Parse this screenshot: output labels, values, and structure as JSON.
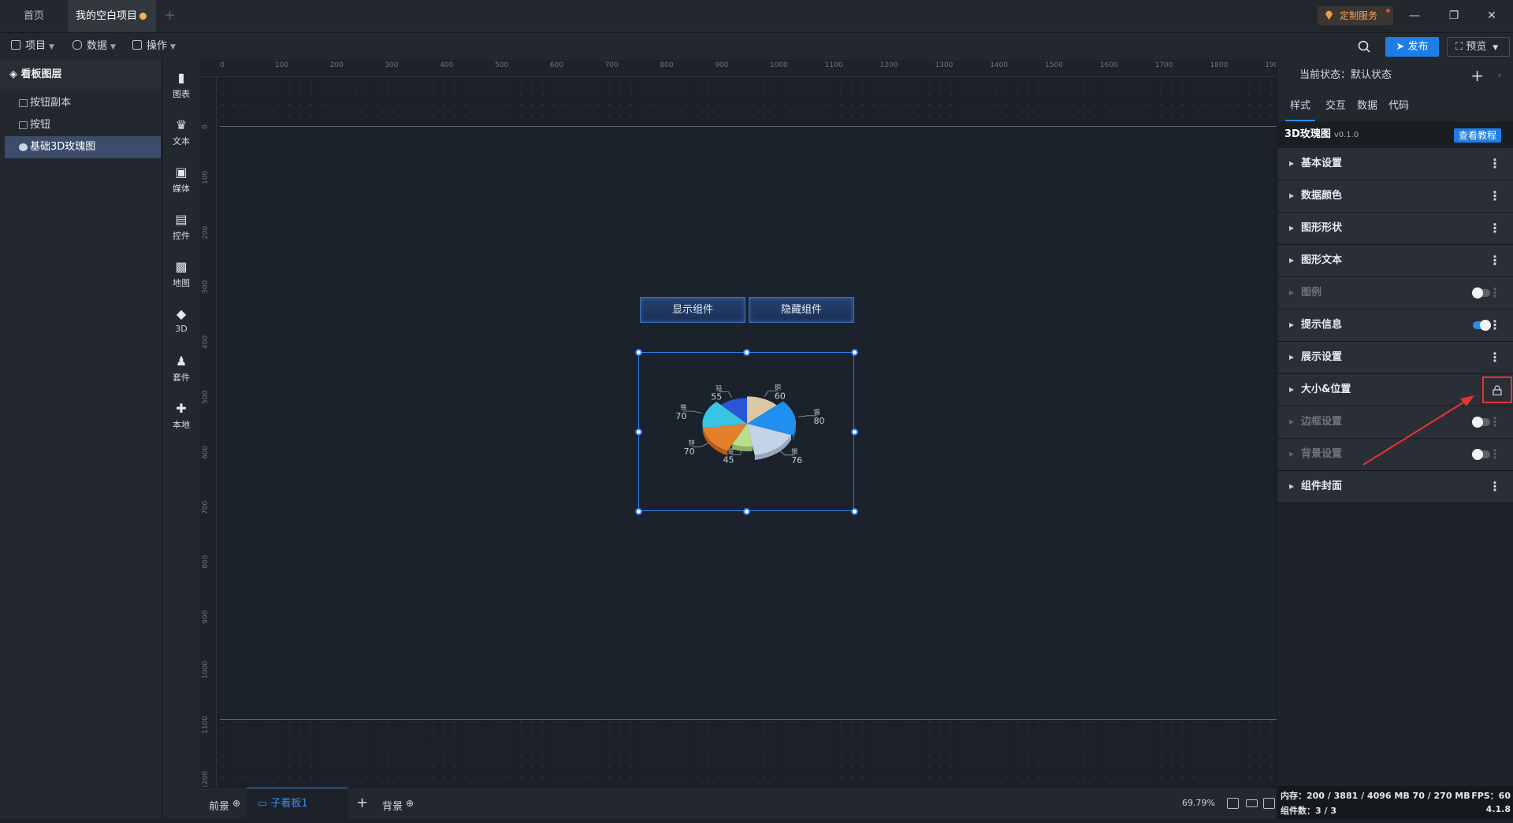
{
  "tabs": {
    "home": "首页",
    "project": "我的空白项目",
    "add": "+"
  },
  "title_actions": {
    "custom_service": "定制服务",
    "minimize": "—",
    "restore": "❐",
    "close": "✕"
  },
  "toolbar": {
    "project": "项目",
    "data": "数据",
    "operate": "操作",
    "publish": "发布",
    "preview": "预览"
  },
  "layers": {
    "title": "看板图层",
    "items": [
      {
        "label": "按钮副本",
        "selected": false
      },
      {
        "label": "按钮",
        "selected": false
      },
      {
        "label": "基础3D玫瑰图",
        "selected": true
      }
    ]
  },
  "components": [
    "图表",
    "文本",
    "媒体",
    "控件",
    "地图",
    "3D",
    "套件",
    "本地"
  ],
  "ruler": {
    "h": [
      "0",
      "100",
      "200",
      "300",
      "400",
      "500",
      "600",
      "700",
      "800",
      "900",
      "1000",
      "1100",
      "1200",
      "1300",
      "1400",
      "1500",
      "1600",
      "1700",
      "1800",
      "1900"
    ],
    "v": [
      "0",
      "100",
      "200",
      "300",
      "400",
      "500",
      "600",
      "700",
      "800",
      "900",
      "1000",
      "1100",
      "1200"
    ]
  },
  "canvas": {
    "show_button": "显示组件",
    "hide_button": "隐藏组件"
  },
  "chart_data": {
    "type": "pie",
    "categories": [
      "铜",
      "锡",
      "银",
      "金",
      "锌",
      "铁",
      "铅"
    ],
    "values": [
      60,
      80,
      76,
      45,
      70,
      70,
      55
    ],
    "title": "",
    "xlabel": "",
    "ylabel": ""
  },
  "bottom": {
    "front": "前景",
    "sub_board": "子看板1",
    "add": "+",
    "background": "背景",
    "zoom": "69.79%"
  },
  "right_panel": {
    "current_state": "当前状态：默认状态",
    "tabs": [
      "样式",
      "交互",
      "数据",
      "代码"
    ],
    "component_name": "3D玫瑰图",
    "version": "v0.1.0",
    "tutorial": "查看教程",
    "sections": [
      {
        "label": "基本设置",
        "disabled": false,
        "toggle": null
      },
      {
        "label": "数据颜色",
        "disabled": false,
        "toggle": null
      },
      {
        "label": "图形形状",
        "disabled": false,
        "toggle": null
      },
      {
        "label": "图形文本",
        "disabled": false,
        "toggle": null
      },
      {
        "label": "图例",
        "disabled": true,
        "toggle": "off"
      },
      {
        "label": "提示信息",
        "disabled": false,
        "toggle": "on"
      },
      {
        "label": "展示设置",
        "disabled": false,
        "toggle": null
      },
      {
        "label": "大小&位置",
        "disabled": false,
        "toggle": null,
        "locked": true
      },
      {
        "label": "边框设置",
        "disabled": true,
        "toggle": "off"
      },
      {
        "label": "背景设置",
        "disabled": true,
        "toggle": "off"
      },
      {
        "label": "组件封面",
        "disabled": false,
        "toggle": null
      }
    ],
    "status": {
      "memory": "内存：200 / 3881 / 4096 MB  70 / 270 MB",
      "fps": "FPS：60",
      "count": "组件数：3 / 3",
      "version": "4.1.8"
    }
  },
  "colors": {
    "accent": "#1d7fe6",
    "selection": "#2f7df0",
    "annotation_red": "#e03434"
  },
  "icons": {
    "search": "search-icon",
    "lock": "lock-icon",
    "more": "more-vertical-icon"
  }
}
